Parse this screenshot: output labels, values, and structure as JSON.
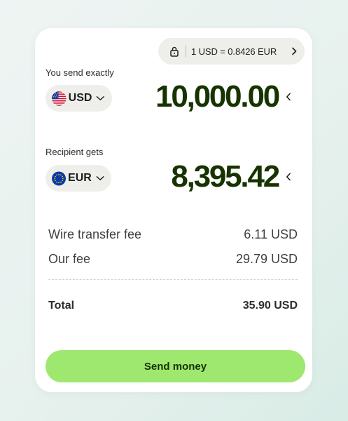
{
  "rate_pill": {
    "text": "1 USD = 0.8426 EUR",
    "lock_icon": "lock-icon",
    "chevron_icon": "chevron-right-icon"
  },
  "send": {
    "label": "You send exactly",
    "currency": "USD",
    "flag_icon": "us-flag-icon",
    "amount": "10,000.00"
  },
  "receive": {
    "label": "Recipient gets",
    "currency": "EUR",
    "flag_icon": "eu-flag-icon",
    "amount": "8,395.42"
  },
  "fees": [
    {
      "label": "Wire transfer fee",
      "value": "6.11 USD"
    },
    {
      "label": "Our fee",
      "value": "29.79 USD"
    }
  ],
  "total": {
    "label": "Total",
    "value": "35.90 USD"
  },
  "button": {
    "label": "Send money"
  },
  "colors": {
    "accent": "#9fe870",
    "amount_text": "#163300",
    "pill_bg": "#eeefea"
  }
}
